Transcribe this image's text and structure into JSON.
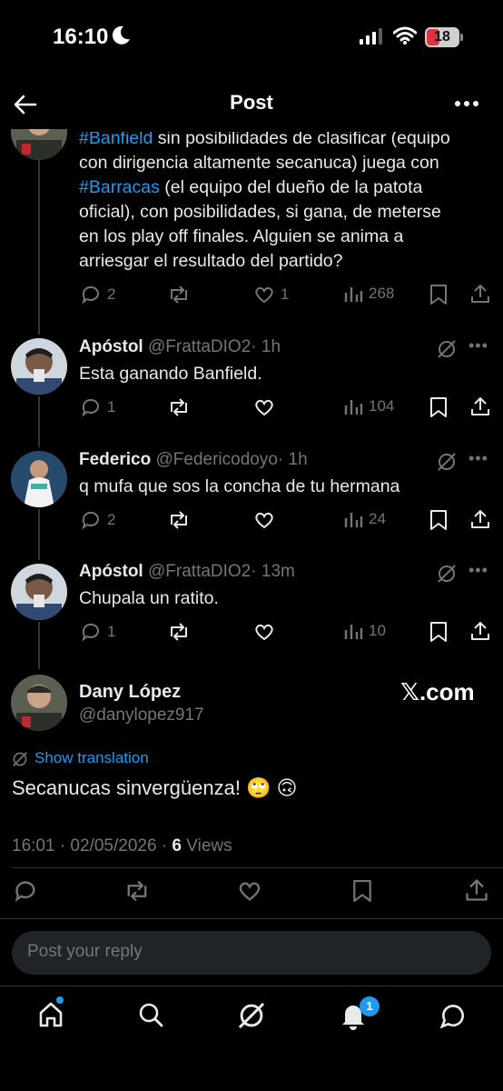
{
  "status_bar": {
    "time": "16:10",
    "battery": "18"
  },
  "header": {
    "title": "Post"
  },
  "parent_post": {
    "line1_hashtag": "#Banfield",
    "line1_rest": " sin posibilidades de clasificar (equipo",
    "line2": "con dirigencia altamente secanuca) juega con",
    "line3_hashtag": "#Barracas",
    "line3_rest": " (el equipo del dueño de la patota",
    "line4": "oficial), con posibilidades, si gana, de meterse",
    "line5": "en los play off finales. Alguien se anima a",
    "line6": "arriesgar el resultado del partido?",
    "replies": "2",
    "likes": "1",
    "views": "268"
  },
  "replies": [
    {
      "name": "Apóstol",
      "handle": "@FrattaDIO2",
      "time": "· 1h",
      "text": "Esta ganando Banfield.",
      "reply_count": "1",
      "views": "104"
    },
    {
      "name": "Federico",
      "handle": "@Federicodoyo",
      "time": "· 1h",
      "text": "q mufa que sos la concha de tu hermana",
      "reply_count": "2",
      "views": "24"
    },
    {
      "name": "Apóstol",
      "handle": "@FrattaDIO2",
      "time": "· 13m",
      "text": "Chupala un ratito.",
      "reply_count": "1",
      "views": "10"
    }
  ],
  "main_post": {
    "name": "Dany López",
    "handle": "@danylopez917",
    "watermark": "𝕏.com",
    "show_translation": "Show translation",
    "text": "Secanucas sinvergüenza! 🙄 🙃",
    "timestamp": "16:01 · 02/05/2026 · ",
    "views_count": "6",
    "views_label": " Views"
  },
  "reply_input": {
    "placeholder": "Post your reply"
  },
  "bottom_nav": {
    "notifications_badge": "1"
  },
  "colors": {
    "accent": "#1d9bf0",
    "muted": "#71767b",
    "background": "#000000"
  }
}
